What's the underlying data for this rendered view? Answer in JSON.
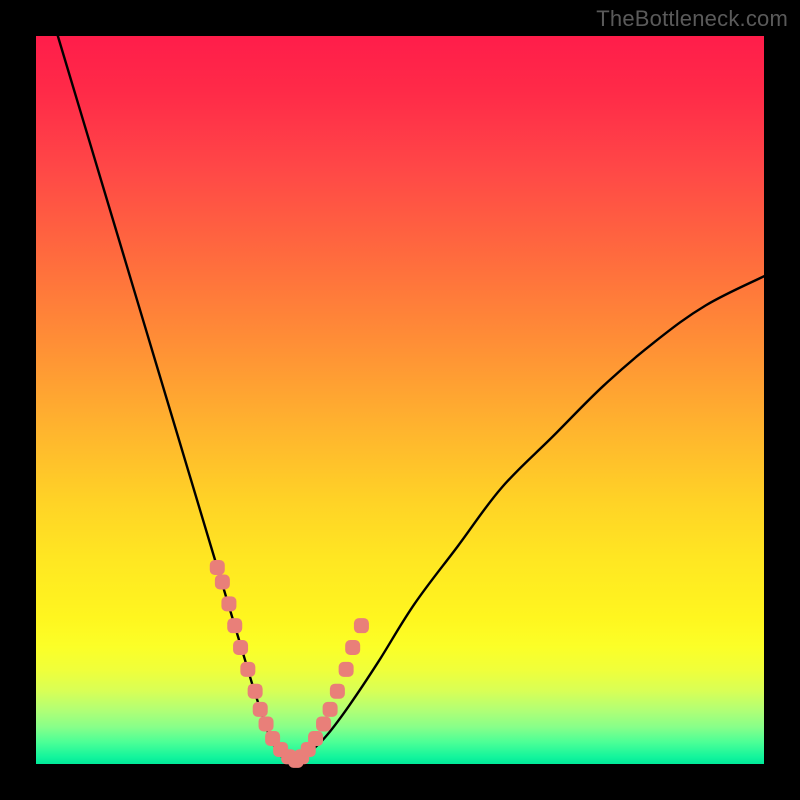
{
  "watermark": "TheBottleneck.com",
  "colors": {
    "frame": "#000000",
    "curve": "#000000",
    "marker": "#e97f79"
  },
  "chart_data": {
    "type": "line",
    "title": "",
    "xlabel": "",
    "ylabel": "",
    "xlim": [
      0,
      100
    ],
    "ylim": [
      0,
      100
    ],
    "grid": false,
    "legend": false,
    "series": [
      {
        "name": "bottleneck-curve",
        "x": [
          3,
          6,
          9,
          12,
          15,
          18,
          21,
          24,
          25.5,
          27,
          28.5,
          30,
          31,
          32,
          33,
          34,
          35,
          36,
          38,
          40,
          43,
          47,
          52,
          58,
          64,
          71,
          78,
          85,
          92,
          100
        ],
        "y": [
          100,
          90,
          80,
          70,
          60,
          50,
          40,
          30,
          25,
          20,
          15,
          10,
          7,
          4,
          2,
          0.8,
          0.4,
          0.8,
          2,
          4,
          8,
          14,
          22,
          30,
          38,
          45,
          52,
          58,
          63,
          67
        ]
      }
    ],
    "markers": {
      "name": "highlight-points",
      "x": [
        24.9,
        25.6,
        26.5,
        27.3,
        28.1,
        29.1,
        30.1,
        30.8,
        31.6,
        32.5,
        33.6,
        34.7,
        35.7,
        36.5,
        37.4,
        38.4,
        39.5,
        40.4,
        41.4,
        42.6,
        43.5,
        44.7
      ],
      "y": [
        27,
        25,
        22,
        19,
        16,
        13,
        10,
        7.5,
        5.5,
        3.5,
        2,
        1,
        0.5,
        1,
        2,
        3.5,
        5.5,
        7.5,
        10,
        13,
        16,
        19
      ]
    }
  }
}
